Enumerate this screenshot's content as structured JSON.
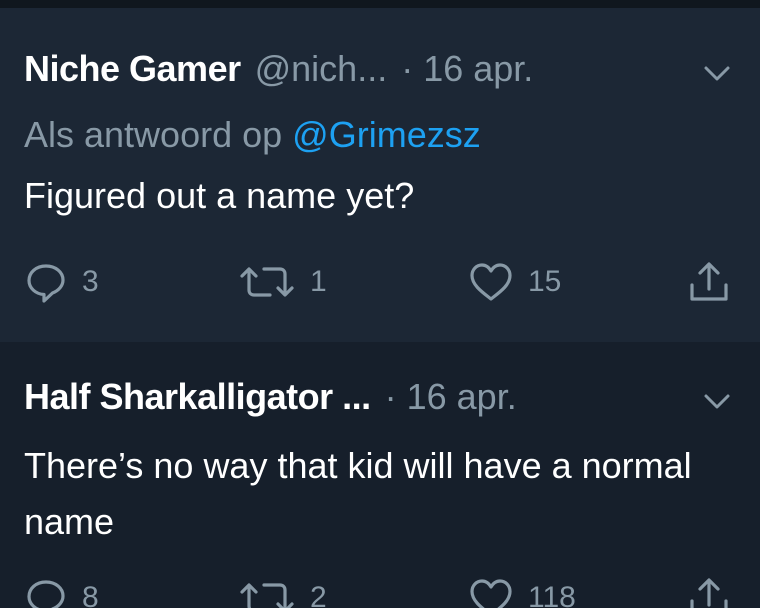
{
  "tweets": [
    {
      "display_name": "Niche Gamer",
      "handle": "@nich...",
      "separator": "·",
      "date": "16 apr.",
      "reply_prefix": "Als antwoord op",
      "reply_mention": "@Grimezsz",
      "text": "Figured out a name yet?",
      "replies": "3",
      "retweets": "1",
      "likes": "15",
      "icons": {
        "menu": "chevron-down-icon",
        "reply": "reply-icon",
        "retweet": "retweet-icon",
        "like": "heart-icon",
        "share": "share-icon"
      }
    },
    {
      "display_name": "Half Sharkalligator ...",
      "separator": "·",
      "date": "16 apr.",
      "text": "There’s no way that kid will have a normal name",
      "replies": "8",
      "retweets": "2",
      "likes": "118"
    }
  ],
  "colors": {
    "background": "#1c2735",
    "background_alt": "#161f2b",
    "text": "#ffffff",
    "muted": "#8899a6",
    "link": "#1da1f2"
  }
}
